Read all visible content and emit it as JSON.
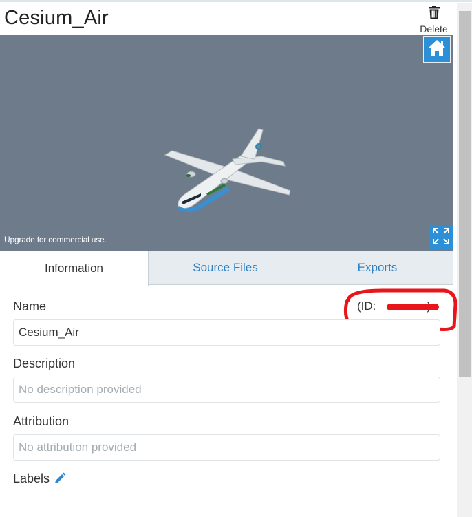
{
  "header": {
    "title": "Cesium_Air",
    "delete_label": "Delete"
  },
  "viewer": {
    "upgrade_text": "Upgrade for commercial use.",
    "home_icon": "home-icon",
    "fullscreen_icon": "expand-icon",
    "background": "#6d7b8b",
    "accent": "#2d8fd5"
  },
  "tabs": [
    {
      "label": "Information",
      "active": true
    },
    {
      "label": "Source Files",
      "active": false
    },
    {
      "label": "Exports",
      "active": false
    }
  ],
  "info": {
    "name_label": "Name",
    "id_label": "(ID:",
    "id_suffix": ")",
    "name_value": "Cesium_Air",
    "description_label": "Description",
    "description_placeholder": "No description provided",
    "attribution_label": "Attribution",
    "attribution_placeholder": "No attribution provided",
    "labels_label": "Labels",
    "labels_edit_icon": "pencil-icon"
  }
}
